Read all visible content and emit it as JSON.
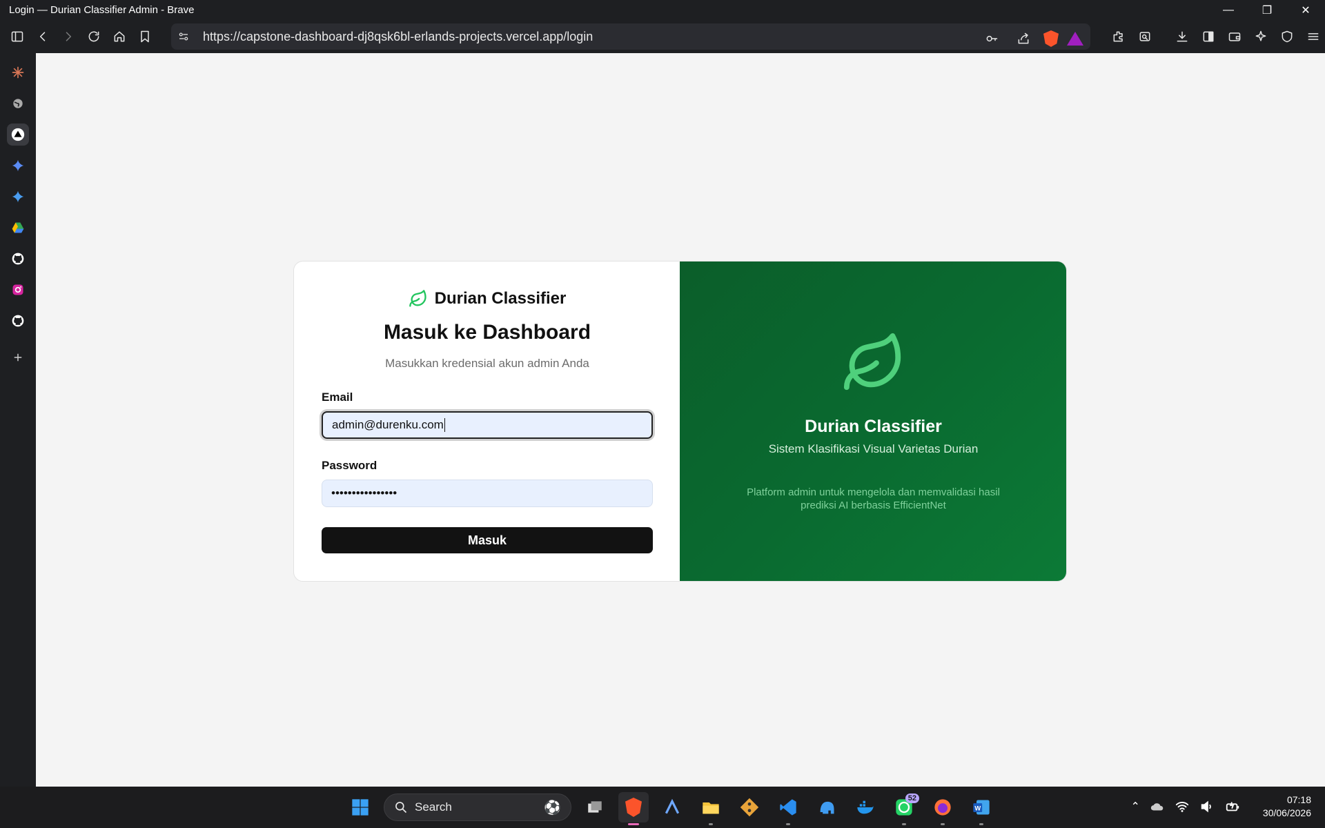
{
  "window": {
    "title": "Login — Durian Classifier Admin - Brave"
  },
  "browser": {
    "url": "https://capstone-dashboard-dj8qsk6bl-erlands-projects.vercel.app/login"
  },
  "sidebar": {
    "items": [
      "claude",
      "globe",
      "vercel",
      "gemini",
      "gemini-2",
      "google-drive",
      "github",
      "instagram",
      "github-2",
      "add"
    ]
  },
  "login": {
    "brand": "Durian Classifier",
    "heading": "Masuk ke Dashboard",
    "subtitle": "Masukkan kredensial akun admin Anda",
    "email_label": "Email",
    "email_value": "admin@durenku.com",
    "password_label": "Password",
    "password_value": "••••••••••••••••",
    "submit_label": "Masuk"
  },
  "promo": {
    "title": "Durian Classifier",
    "subtitle": "Sistem Klasifikasi Visual Varietas Durian",
    "description": "Platform admin untuk mengelola dan memvalidasi hasil prediksi AI berbasis EfficientNet"
  },
  "taskbar": {
    "search_label": "Search",
    "whatsapp_badge": "52",
    "time": "07:18",
    "date": "30/06/2026"
  },
  "colors": {
    "accent_green": "#22c55e",
    "panel_green": "#0a6a30",
    "button_dark": "#121212"
  }
}
